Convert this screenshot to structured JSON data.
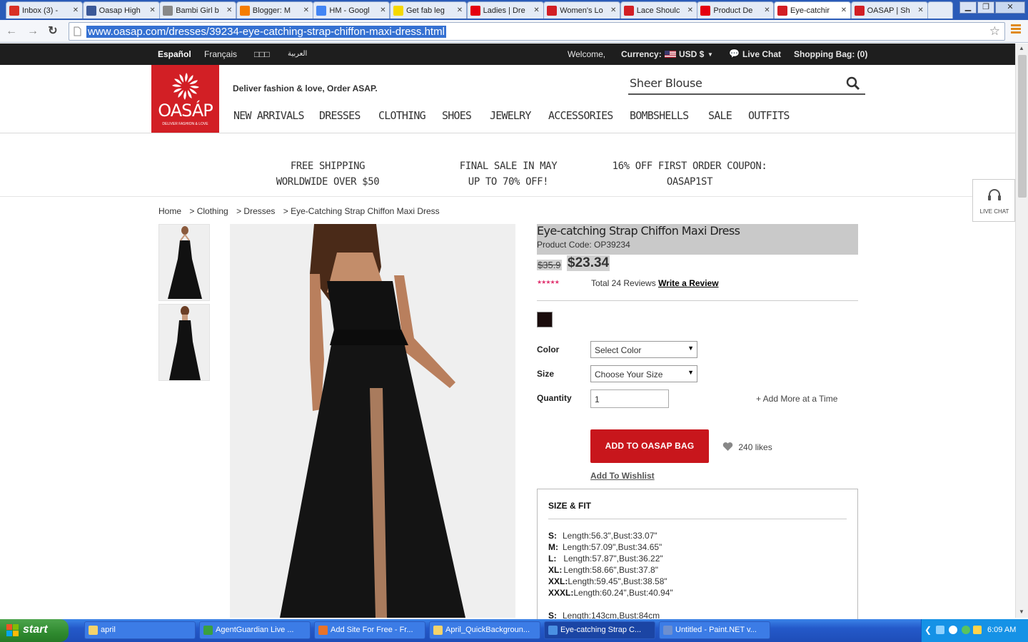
{
  "browser": {
    "tabs": [
      {
        "label": "Inbox (3) -",
        "icon": "gmail-icon",
        "color": "#d93025"
      },
      {
        "label": "Oasap High",
        "icon": "facebook-icon",
        "color": "#3b5998"
      },
      {
        "label": "Bambi Girl b",
        "icon": "bambi-icon",
        "color": "#888888"
      },
      {
        "label": "Blogger: M",
        "icon": "blogger-icon",
        "color": "#f57d00"
      },
      {
        "label": "HM - Googl",
        "icon": "google-icon",
        "color": "#4285f4"
      },
      {
        "label": "Get fab leg",
        "icon": "21-icon",
        "color": "#f5d800"
      },
      {
        "label": "Ladies | Dre",
        "icon": "hm-icon",
        "color": "#e50010"
      },
      {
        "label": "Women's Lo",
        "icon": "oasap-icon",
        "color": "#d21f25"
      },
      {
        "label": "Lace Shoulc",
        "icon": "oasap-icon",
        "color": "#d21f25"
      },
      {
        "label": "Product De",
        "icon": "hm-icon",
        "color": "#e50010"
      },
      {
        "label": "Eye-catchir",
        "icon": "oasap-icon",
        "color": "#d21f25"
      },
      {
        "label": "OASAP | Sh",
        "icon": "oasap-icon",
        "color": "#d21f25"
      }
    ],
    "url": "www.oasap.com/dresses/39234-eye-catching-strap-chiffon-maxi-dress.html"
  },
  "topbar": {
    "languages": [
      "Español",
      "Français",
      "□□□",
      "العربية"
    ],
    "welcome": "Welcome,",
    "currency_label": "Currency:",
    "currency_value": "USD $",
    "live_chat": "Live Chat",
    "shopping_bag": "Shopping Bag: (0)"
  },
  "header": {
    "logo_text": "OASÁP",
    "logo_subtext": "DELIVER FASHION & LOVE",
    "tagline": "Deliver fashion & love, Order ASAP.",
    "search_value": "Sheer Blouse",
    "nav": [
      "NEW ARRIVALS",
      "DRESSES",
      "CLOTHING",
      "SHOES",
      "JEWELRY",
      "ACCESSORIES",
      "BOMBSHELLS",
      "SALE",
      "OUTFITS"
    ]
  },
  "promos": [
    {
      "line1": "FREE SHIPPING",
      "line2": "WORLDWIDE OVER $50"
    },
    {
      "line1": "FINAL SALE IN MAY",
      "line2": "UP TO 70% OFF!"
    },
    {
      "line1": "16% OFF FIRST ORDER COUPON:",
      "line2": "OASAP1ST"
    }
  ],
  "side_widget": {
    "label": "LIVE CHAT"
  },
  "breadcrumb": [
    "Home",
    "> Clothing",
    "> Dresses",
    "> Eye-Catching Strap Chiffon Maxi Dress"
  ],
  "product": {
    "title": "Eye-catching Strap Chiffon Maxi Dress",
    "code": "Product Code: OP39234",
    "old_price": "$35.9",
    "new_price": "$23.34",
    "stars": "★★★★★",
    "rating": 5,
    "reviews_text": "Total 24 Reviews",
    "write_review": "Write a Review",
    "swatch_color": "#1a0c0c",
    "color_label": "Color",
    "color_select": "Select Color",
    "size_label": "Size",
    "size_select": "Choose Your Size",
    "quantity_label": "Quantity",
    "quantity_value": "1",
    "add_more": "+ Add More at a Time",
    "add_to_bag": "ADD TO OASAP BAG",
    "likes": "240  likes",
    "wishlist": "Add To Wishlist"
  },
  "size_fit": {
    "title": "SIZE & FIT",
    "rows": [
      {
        "size": "S:",
        "spec": "Length:56.3\",Bust:33.07\""
      },
      {
        "size": "M:",
        "spec": "Length:57.09\",Bust:34.65\""
      },
      {
        "size": "L:",
        "spec": "Length:57.87\",Bust:36.22\""
      },
      {
        "size": "XL:",
        "spec": "Length:58.66\",Bust:37.8\""
      },
      {
        "size": "XXL:",
        "spec": "Length:59.45\",Bust:38.58\""
      },
      {
        "size": "XXXL:",
        "spec": "Length:60.24\",Bust:40.94\""
      }
    ],
    "metric_row": {
      "size": "S:",
      "spec": "Length:143cm,Bust:84cm"
    }
  },
  "taskbar": {
    "start": "start",
    "tasks": [
      {
        "label": "april",
        "color": "#f4d36b"
      },
      {
        "label": "AgentGuardian Live ...",
        "color": "#3aa040"
      },
      {
        "label": "Add Site For Free - Fr...",
        "color": "#e8732a"
      },
      {
        "label": "April_QuickBackgroun...",
        "color": "#f4d36b"
      },
      {
        "label": "Eye-catching Strap C...",
        "color": "#4a90e2"
      },
      {
        "label": "Untitled - Paint.NET v...",
        "color": "#6d8fd0"
      }
    ],
    "clock": "6:09 AM"
  }
}
